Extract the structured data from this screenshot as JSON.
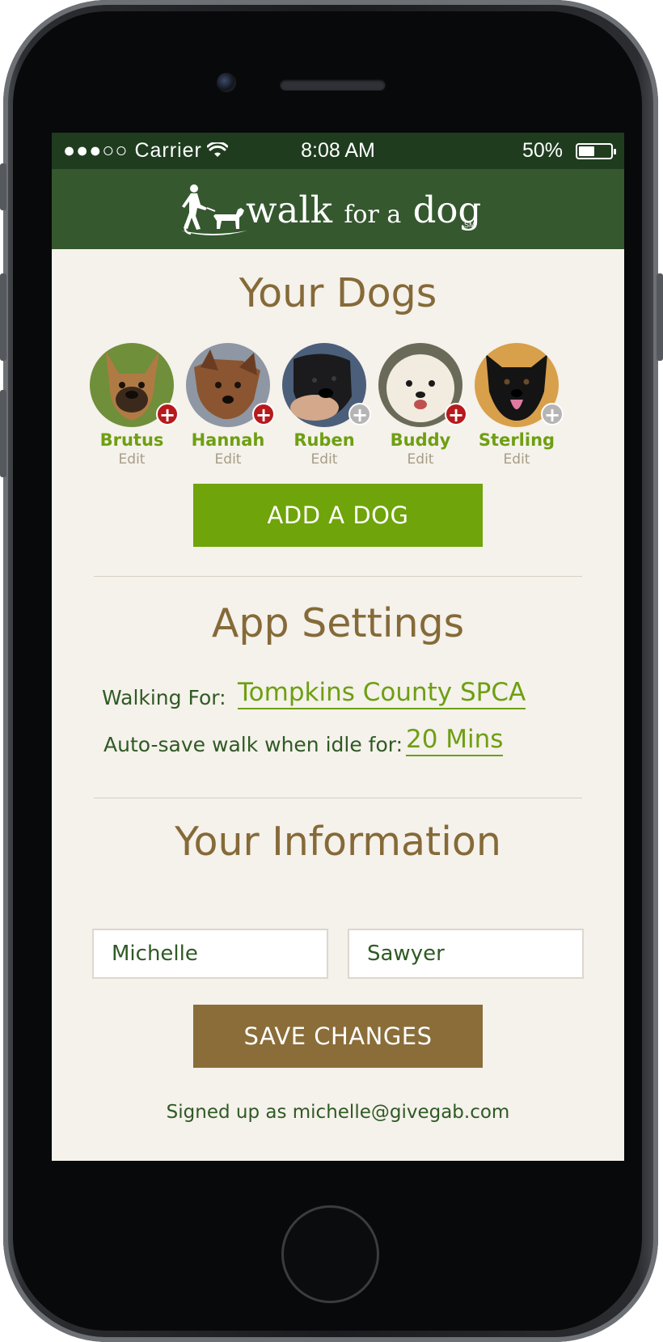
{
  "status_bar": {
    "signal": "●●●○○",
    "carrier": "Carrier",
    "time": "8:08 AM",
    "battery": "50%",
    "battery_level": 0.5
  },
  "header": {
    "logo_text_walk": "walk",
    "logo_text_for_a": "for a",
    "logo_text_dog": "dog",
    "logo_mark": "SM"
  },
  "dogs_section": {
    "title": "Your Dogs",
    "dogs": [
      {
        "name": "Brutus",
        "edit": "Edit",
        "badge": "+",
        "badge_color": "#b8191c"
      },
      {
        "name": "Hannah",
        "edit": "Edit",
        "badge": "+",
        "badge_color": "#b8191c"
      },
      {
        "name": "Ruben",
        "edit": "Edit",
        "badge": "+",
        "badge_color": "#b5b5b5"
      },
      {
        "name": "Buddy",
        "edit": "Edit",
        "badge": "+",
        "badge_color": "#b8191c"
      },
      {
        "name": "Sterling",
        "edit": "Edit",
        "badge": "+",
        "badge_color": "#b5b5b5"
      }
    ],
    "add_button": "ADD A DOG"
  },
  "settings_section": {
    "title": "App Settings",
    "walking_for_label": "Walking For:",
    "walking_for_value": "Tompkins County SPCA",
    "autosave_label": "Auto-save walk when idle for:",
    "autosave_value": "20 Mins"
  },
  "info_section": {
    "title": "Your Information",
    "first_name": "Michelle",
    "last_name": "Sawyer",
    "save_button": "SAVE CHANGES",
    "signed_up": "Signed up as michelle@givegab.com"
  },
  "colors": {
    "header_green": "#35582f",
    "accent_green": "#6fa40a",
    "brown": "#8a6d38",
    "title_brown": "#856a38",
    "background": "#f5f1eb"
  }
}
